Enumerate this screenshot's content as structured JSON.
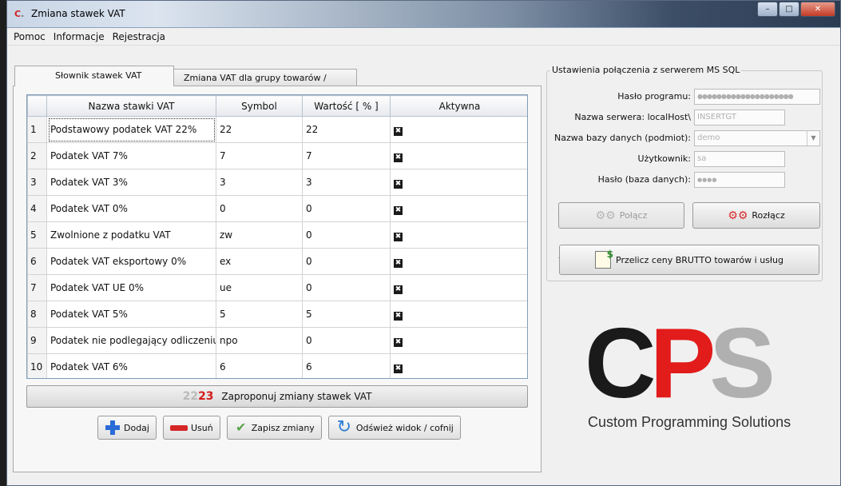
{
  "window": {
    "title": "Zmiana stawek VAT",
    "controls": [
      "–",
      "□",
      "✕"
    ]
  },
  "menu": [
    "Pomoc",
    "Informacje",
    "Rejestracja"
  ],
  "tabs": [
    {
      "label": "Słownik stawek VAT",
      "active": true
    },
    {
      "label": "Zmiana VAT dla grupy towarów / usług",
      "active": false
    }
  ],
  "table": {
    "columns": [
      "",
      "Nazwa stawki VAT",
      "Symbol",
      "Wartość [ % ]",
      "Aktywna"
    ],
    "rows": [
      {
        "n": "1",
        "name": "Podstawowy podatek VAT 22%",
        "symbol": "22",
        "value": "22",
        "active": true
      },
      {
        "n": "2",
        "name": "Podatek VAT 7%",
        "symbol": "7",
        "value": "7",
        "active": true
      },
      {
        "n": "3",
        "name": "Podatek VAT 3%",
        "symbol": "3",
        "value": "3",
        "active": true
      },
      {
        "n": "4",
        "name": "Podatek VAT 0%",
        "symbol": "0",
        "value": "0",
        "active": true
      },
      {
        "n": "5",
        "name": "Zwolnione z podatku VAT",
        "symbol": "zw",
        "value": "0",
        "active": true
      },
      {
        "n": "6",
        "name": "Podatek VAT eksportowy 0%",
        "symbol": "ex",
        "value": "0",
        "active": true
      },
      {
        "n": "7",
        "name": "Podatek VAT UE 0%",
        "symbol": "ue",
        "value": "0",
        "active": true
      },
      {
        "n": "8",
        "name": "Podatek VAT 5%",
        "symbol": "5",
        "value": "5",
        "active": true
      },
      {
        "n": "9",
        "name": "Podatek nie podlegający odliczeniu",
        "symbol": "npo",
        "value": "0",
        "active": true
      },
      {
        "n": "10",
        "name": "Podatek VAT 6%",
        "symbol": "6",
        "value": "6",
        "active": true
      }
    ]
  },
  "propose": {
    "icon_a": "22",
    "icon_b": "23",
    "label": "Zaproponuj zmiany stawek VAT"
  },
  "actions": {
    "add": "Dodaj",
    "remove": "Usuń",
    "save": "Zapisz zmiany",
    "refresh": "Odśwież widok / cofnij"
  },
  "connection": {
    "group_title": "Ustawienia połączenia z serwerem MS SQL",
    "program_password_label": "Hasło programu:",
    "program_password_value": "●●●●●●●●●●●●●●●●●●●●",
    "server_label": "Nazwa serwera: localHost\\",
    "server_value": "INSERTGT",
    "database_label": "Nazwa bazy danych (podmiot):",
    "database_value": "demo",
    "user_label": "Użytkownik:",
    "user_value": "sa",
    "db_password_label": "Hasło (baza danych):",
    "db_password_value": "●●●●",
    "connect": "Połącz",
    "disconnect": "Rozłącz",
    "recalc": "Przelicz ceny BRUTTO towarów i usług"
  },
  "logo": {
    "letters": [
      "C",
      "P",
      "S"
    ],
    "subtitle": "Custom Programming Solutions"
  },
  "colors": {
    "logo_red": "#e21b1b",
    "logo_grey": "#b0b0b0",
    "accent_blue": "#2a6bd6"
  }
}
